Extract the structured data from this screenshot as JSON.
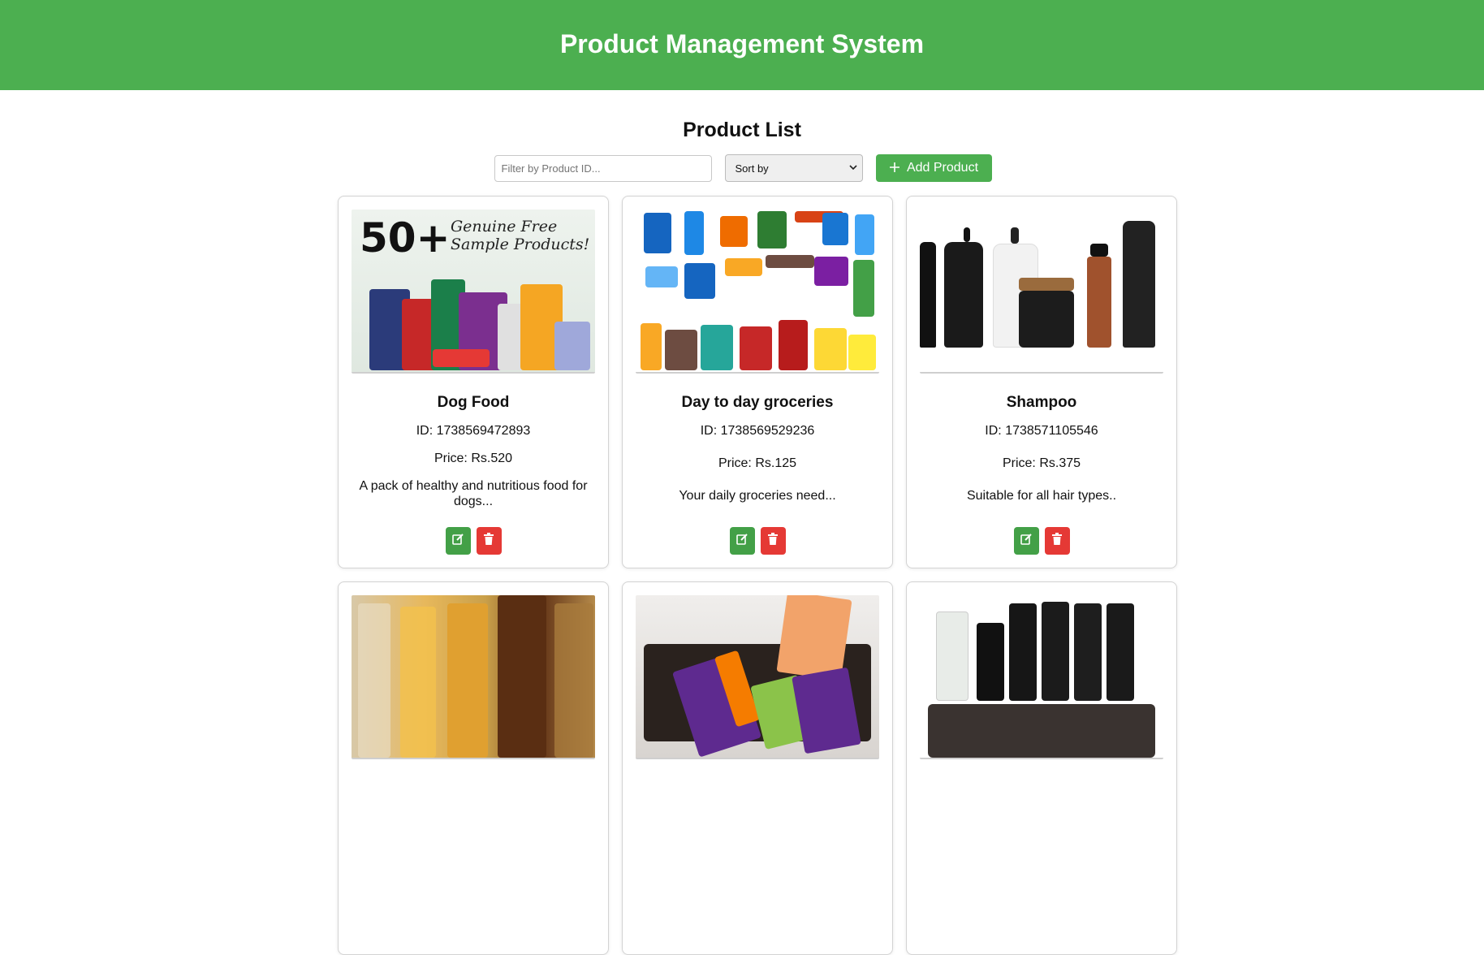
{
  "header": {
    "title": "Product Management System"
  },
  "page": {
    "list_title": "Product List"
  },
  "controls": {
    "filter_placeholder": "Filter by Product ID...",
    "sort_label": "Sort by",
    "add_label": "Add Product"
  },
  "thumbs": {
    "dog_big": "50+",
    "dog_small_1": "Genuine Free",
    "dog_small_2": "Sample Products!"
  },
  "products": [
    {
      "name": "Dog Food",
      "id": "ID: 1738569472893",
      "price": "Price: Rs.520",
      "desc": "A pack of healthy and nutritious food for dogs..."
    },
    {
      "name": "Day to day groceries",
      "id": "ID: 1738569529236",
      "price": "Price: Rs.125",
      "desc": "Your daily groceries need..."
    },
    {
      "name": "Shampoo",
      "id": "ID: 1738571105546",
      "price": "Price: Rs.375",
      "desc": "Suitable for all hair types.."
    }
  ],
  "colors": {
    "header": "#4caf50",
    "edit": "#43a047",
    "delete": "#e53935"
  },
  "icons": {
    "edit": "edit-icon",
    "delete": "trash-icon",
    "add": "plus-icon"
  }
}
